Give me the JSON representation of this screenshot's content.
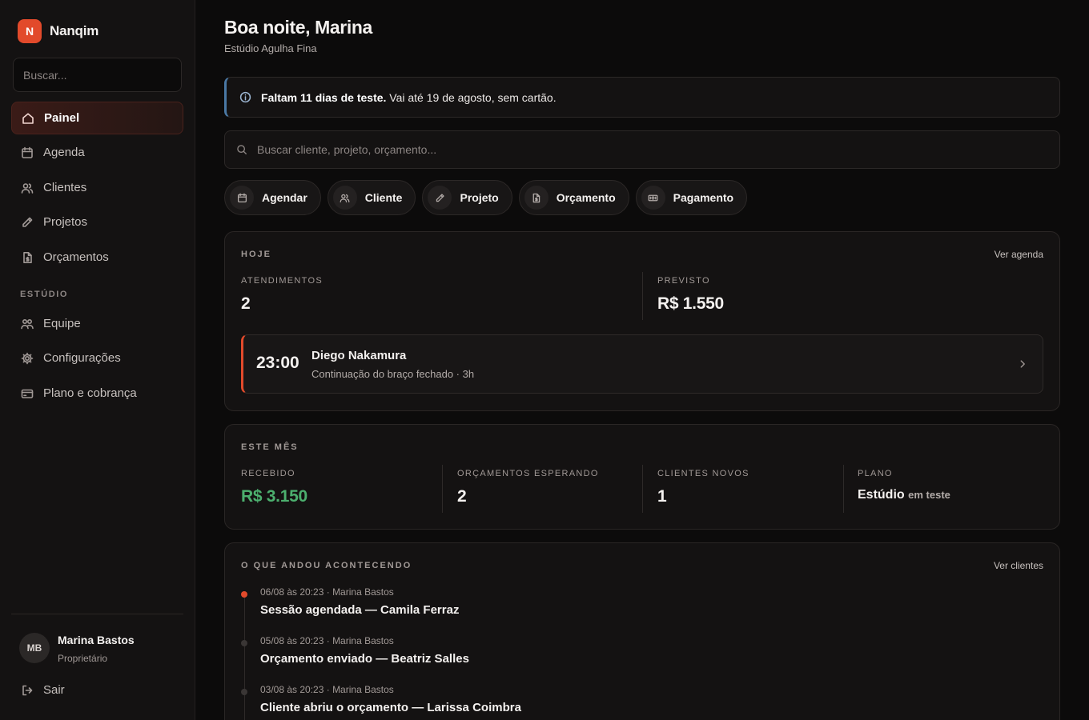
{
  "brand": {
    "logo_letter": "N",
    "name": "Nanqim"
  },
  "sidebar": {
    "search_placeholder": "Buscar...",
    "nav": [
      {
        "label": "Painel",
        "icon": "home-icon",
        "active": true
      },
      {
        "label": "Agenda",
        "icon": "calendar-icon"
      },
      {
        "label": "Clientes",
        "icon": "users-icon"
      },
      {
        "label": "Projetos",
        "icon": "pen-icon"
      },
      {
        "label": "Orçamentos",
        "icon": "document-dollar-icon"
      }
    ],
    "section_title": "ESTÚDIO",
    "studio_nav": [
      {
        "label": "Equipe",
        "icon": "team-icon"
      },
      {
        "label": "Configurações",
        "icon": "gear-icon"
      },
      {
        "label": "Plano e cobrança",
        "icon": "credit-card-icon"
      }
    ],
    "user": {
      "initials": "MB",
      "name": "Marina Bastos",
      "role": "Proprietário"
    },
    "logout_label": "Sair"
  },
  "header": {
    "greeting": "Boa noite, Marina",
    "studio": "Estúdio Agulha Fina"
  },
  "trial": {
    "strong": "Faltam 11 dias de teste.",
    "rest": "Vai até 19 de agosto, sem cartão."
  },
  "search": {
    "placeholder": "Buscar cliente, projeto, orçamento..."
  },
  "quick_actions": [
    {
      "label": "Agendar",
      "icon": "calendar-icon"
    },
    {
      "label": "Cliente",
      "icon": "users-icon"
    },
    {
      "label": "Projeto",
      "icon": "pen-icon"
    },
    {
      "label": "Orçamento",
      "icon": "document-dollar-icon"
    },
    {
      "label": "Pagamento",
      "icon": "banknote-icon"
    }
  ],
  "today": {
    "title": "HOJE",
    "link": "Ver agenda",
    "appointments_label": "ATENDIMENTOS",
    "appointments_value": "2",
    "forecast_label": "PREVISTO",
    "forecast_value": "R$ 1.550",
    "next": {
      "time": "23:00",
      "client": "Diego Nakamura",
      "description": "Continuação do braço fechado · 3h"
    }
  },
  "month": {
    "title": "ESTE MÊS",
    "stats": [
      {
        "label": "RECEBIDO",
        "value": "R$ 3.150"
      },
      {
        "label": "ORÇAMENTOS ESPERANDO",
        "value": "2"
      },
      {
        "label": "CLIENTES NOVOS",
        "value": "1"
      }
    ],
    "plan": {
      "label": "PLANO",
      "name": "Estúdio",
      "status": "em teste"
    }
  },
  "activity": {
    "title": "O QUE ANDOU ACONTECENDO",
    "link": "Ver clientes",
    "items": [
      {
        "meta": "06/08 às 20:23 · Marina Bastos",
        "text": "Sessão agendada — Camila Ferraz",
        "highlight": true
      },
      {
        "meta": "05/08 às 20:23 · Marina Bastos",
        "text": "Orçamento enviado — Beatriz Salles"
      },
      {
        "meta": "03/08 às 20:23 · Marina Bastos",
        "text": "Cliente abriu o orçamento — Larissa Coimbra"
      }
    ]
  },
  "colors": {
    "accent": "#e24a2b",
    "info": "#4a78a4",
    "positive": "#4caf6e",
    "background": "#0c0b0b",
    "surface": "#141212"
  }
}
